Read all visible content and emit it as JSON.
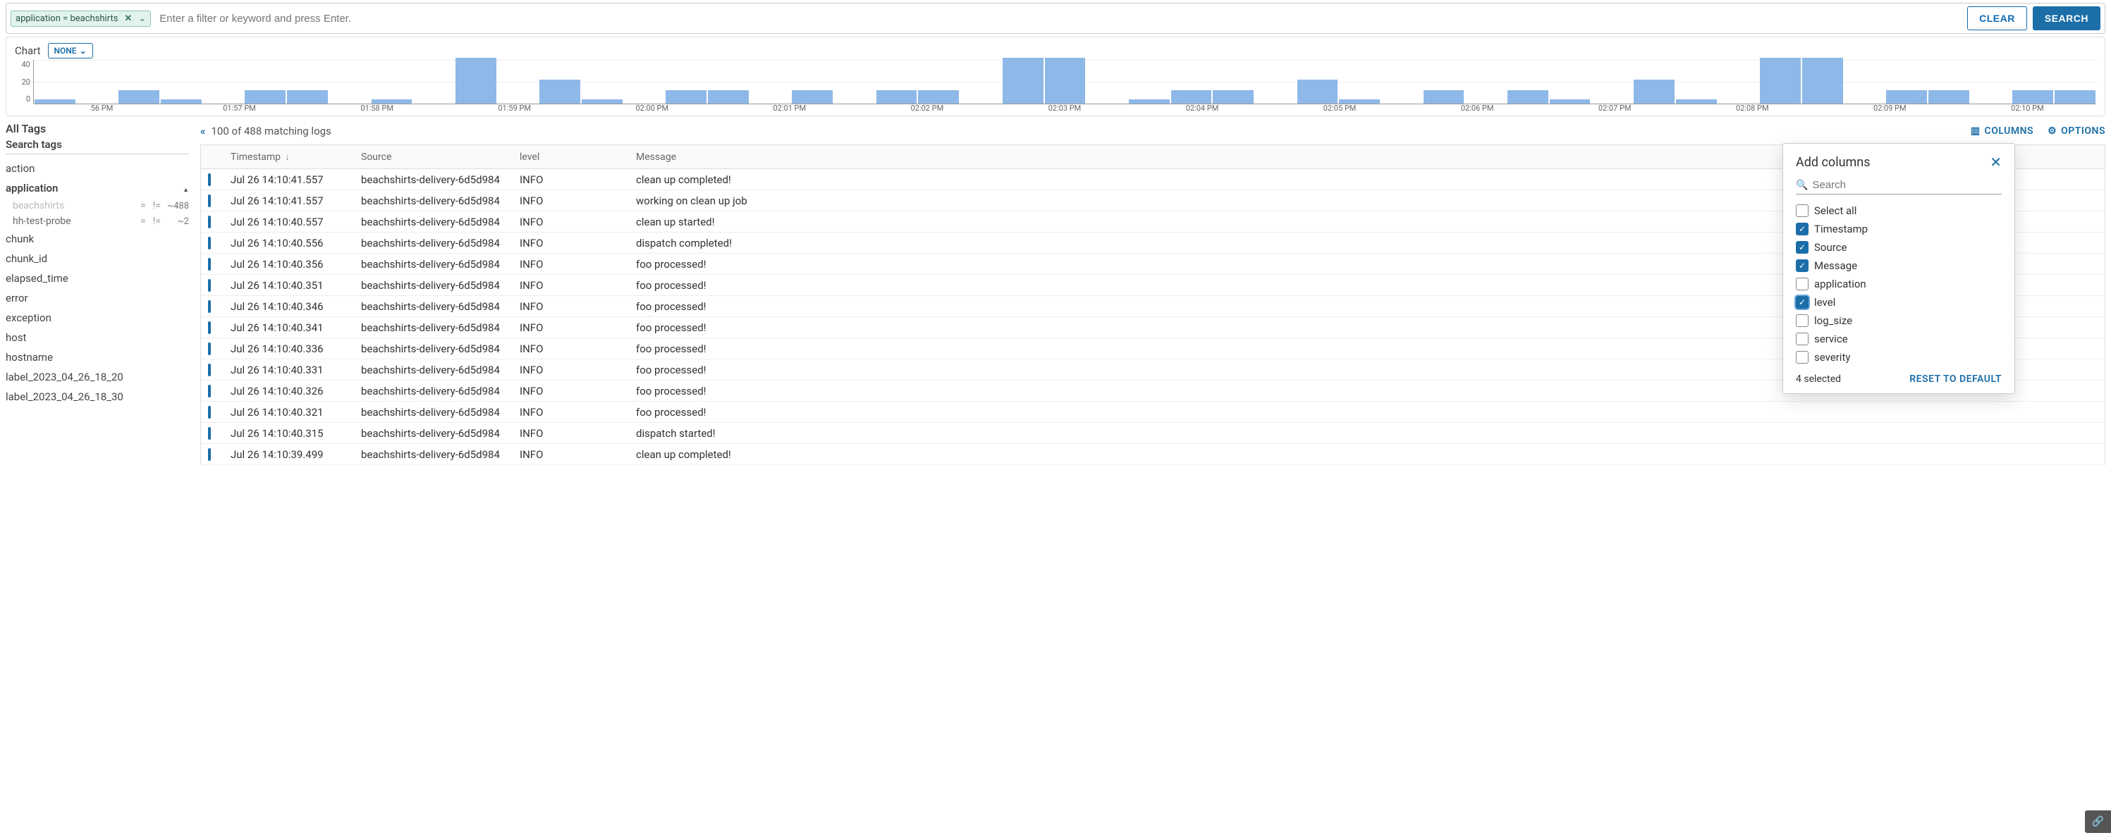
{
  "search": {
    "chip_label": "application = beachshirts",
    "placeholder": "Enter a filter or keyword and press Enter.",
    "clear": "CLEAR",
    "search": "SEARCH"
  },
  "chart_header": {
    "label": "Chart",
    "dropdown": "NONE"
  },
  "chart_data": {
    "type": "bar",
    "ylim": [
      0,
      40
    ],
    "yticks": [
      40,
      20,
      0
    ],
    "categories": [
      "56 PM",
      "01:57 PM",
      "01:58 PM",
      "01:59 PM",
      "02:00 PM",
      "02:01 PM",
      "02:02 PM",
      "02:03 PM",
      "02:04 PM",
      "02:05 PM",
      "02:06 PM",
      "02:07 PM",
      "02:08 PM",
      "02:09 PM",
      "02:10 PM"
    ],
    "values": [
      4,
      0,
      12,
      4,
      0,
      12,
      12,
      0,
      4,
      0,
      42,
      0,
      22,
      4,
      0,
      12,
      12,
      0,
      12,
      0,
      12,
      12,
      0,
      42,
      42,
      0,
      4,
      12,
      12,
      0,
      22,
      4,
      0,
      12,
      0,
      12,
      4,
      0,
      22,
      4,
      0,
      42,
      42,
      0,
      12,
      12,
      0,
      12,
      12
    ]
  },
  "sidebar": {
    "all_tags": "All Tags",
    "search_tags": "Search tags",
    "tags": [
      "action",
      "application",
      "chunk",
      "chunk_id",
      "elapsed_time",
      "error",
      "exception",
      "host",
      "hostname",
      "label_2023_04_26_18_20",
      "label_2023_04_26_18_30"
    ],
    "app_values": [
      {
        "name": "beachshirts",
        "eq": "=",
        "ne": "!=",
        "count": "~488"
      },
      {
        "name": "hh-test-probe",
        "eq": "=",
        "ne": "!=",
        "count": "~2"
      }
    ]
  },
  "results": {
    "count_label": "100 of 488 matching logs",
    "columns_btn": "COLUMNS",
    "options_btn": "OPTIONS",
    "headers": {
      "ts": "Timestamp",
      "src": "Source",
      "lvl": "level",
      "msg": "Message"
    },
    "rows": [
      {
        "ts": "Jul 26 14:10:41.557",
        "src": "beachshirts-delivery-6d5d984",
        "lvl": "INFO",
        "msg": "clean up completed!"
      },
      {
        "ts": "Jul 26 14:10:41.557",
        "src": "beachshirts-delivery-6d5d984",
        "lvl": "INFO",
        "msg": "working on clean up job"
      },
      {
        "ts": "Jul 26 14:10:40.557",
        "src": "beachshirts-delivery-6d5d984",
        "lvl": "INFO",
        "msg": "clean up started!"
      },
      {
        "ts": "Jul 26 14:10:40.556",
        "src": "beachshirts-delivery-6d5d984",
        "lvl": "INFO",
        "msg": "dispatch completed!"
      },
      {
        "ts": "Jul 26 14:10:40.356",
        "src": "beachshirts-delivery-6d5d984",
        "lvl": "INFO",
        "msg": "foo processed!"
      },
      {
        "ts": "Jul 26 14:10:40.351",
        "src": "beachshirts-delivery-6d5d984",
        "lvl": "INFO",
        "msg": "foo processed!"
      },
      {
        "ts": "Jul 26 14:10:40.346",
        "src": "beachshirts-delivery-6d5d984",
        "lvl": "INFO",
        "msg": "foo processed!"
      },
      {
        "ts": "Jul 26 14:10:40.341",
        "src": "beachshirts-delivery-6d5d984",
        "lvl": "INFO",
        "msg": "foo processed!"
      },
      {
        "ts": "Jul 26 14:10:40.336",
        "src": "beachshirts-delivery-6d5d984",
        "lvl": "INFO",
        "msg": "foo processed!"
      },
      {
        "ts": "Jul 26 14:10:40.331",
        "src": "beachshirts-delivery-6d5d984",
        "lvl": "INFO",
        "msg": "foo processed!"
      },
      {
        "ts": "Jul 26 14:10:40.326",
        "src": "beachshirts-delivery-6d5d984",
        "lvl": "INFO",
        "msg": "foo processed!"
      },
      {
        "ts": "Jul 26 14:10:40.321",
        "src": "beachshirts-delivery-6d5d984",
        "lvl": "INFO",
        "msg": "foo processed!"
      },
      {
        "ts": "Jul 26 14:10:40.315",
        "src": "beachshirts-delivery-6d5d984",
        "lvl": "INFO",
        "msg": "dispatch started!"
      },
      {
        "ts": "Jul 26 14:10:39.499",
        "src": "beachshirts-delivery-6d5d984",
        "lvl": "INFO",
        "msg": "clean up completed!"
      }
    ]
  },
  "popup": {
    "title": "Add columns",
    "search_placeholder": "Search",
    "options": [
      {
        "label": "Select all",
        "checked": false
      },
      {
        "label": "Timestamp",
        "checked": true
      },
      {
        "label": "Source",
        "checked": true
      },
      {
        "label": "Message",
        "checked": true
      },
      {
        "label": "application",
        "checked": false
      },
      {
        "label": "level",
        "checked": true,
        "focus": true
      },
      {
        "label": "log_size",
        "checked": false
      },
      {
        "label": "service",
        "checked": false
      },
      {
        "label": "severity",
        "checked": false
      }
    ],
    "selected_text": "4 selected",
    "reset": "RESET TO DEFAULT"
  }
}
